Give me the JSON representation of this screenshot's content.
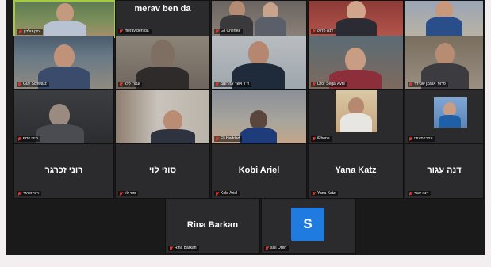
{
  "meeting": {
    "participants": [
      {
        "id": "p1",
        "label": "עידן גולדין",
        "type": "video"
      },
      {
        "id": "p2",
        "label": "merav ben da",
        "center_name": "merav ben da",
        "type": "name"
      },
      {
        "id": "p3",
        "label": "Gil Cherrke",
        "type": "video"
      },
      {
        "id": "p4",
        "label": "דנה פרנק",
        "type": "video"
      },
      {
        "id": "p5",
        "label": "",
        "type": "video"
      },
      {
        "id": "p6",
        "label": "Guy Schwarz",
        "type": "video"
      },
      {
        "id": "p7",
        "label": "עמרי פלג",
        "type": "video"
      },
      {
        "id": "p8",
        "label": "ד\"ר אשר אהרונוב",
        "type": "video"
      },
      {
        "id": "p9",
        "label": "Dror Segal Avni",
        "type": "video"
      },
      {
        "id": "p10",
        "label": "פרופ' ארגמן שניידר",
        "type": "video"
      },
      {
        "id": "p11",
        "label": "מירי יוסף",
        "type": "video"
      },
      {
        "id": "p12",
        "label": "",
        "type": "video"
      },
      {
        "id": "p13",
        "label": "Eli Haddad",
        "type": "video"
      },
      {
        "id": "p14",
        "label": "iPhone",
        "type": "video"
      },
      {
        "id": "p15",
        "label": "עמרי מעודי",
        "type": "video"
      },
      {
        "id": "p16",
        "label": "רוני זכרגר",
        "center_name": "רוני זכרגר",
        "type": "name"
      },
      {
        "id": "p17",
        "label": "סוזי לוי",
        "center_name": "סוזי לוי",
        "type": "name"
      },
      {
        "id": "p18",
        "label": "Kobi Ariel",
        "center_name": "Kobi Ariel",
        "type": "name"
      },
      {
        "id": "p19",
        "label": "Yana Katz",
        "center_name": "Yana Katz",
        "type": "name"
      },
      {
        "id": "p20",
        "label": "דנה עגור",
        "center_name": "דנה עגור",
        "type": "name"
      },
      {
        "id": "p21",
        "label": "Rina Barkan",
        "center_name": "Rina Barkan",
        "type": "name"
      },
      {
        "id": "p22",
        "label": "sali Oren",
        "avatar_letter": "S",
        "type": "avatar"
      }
    ]
  },
  "colors": {
    "active_speaker_border": "#a6cc3b",
    "muted_mic": "#e4342f",
    "avatar_blue": "#1f7be0"
  }
}
